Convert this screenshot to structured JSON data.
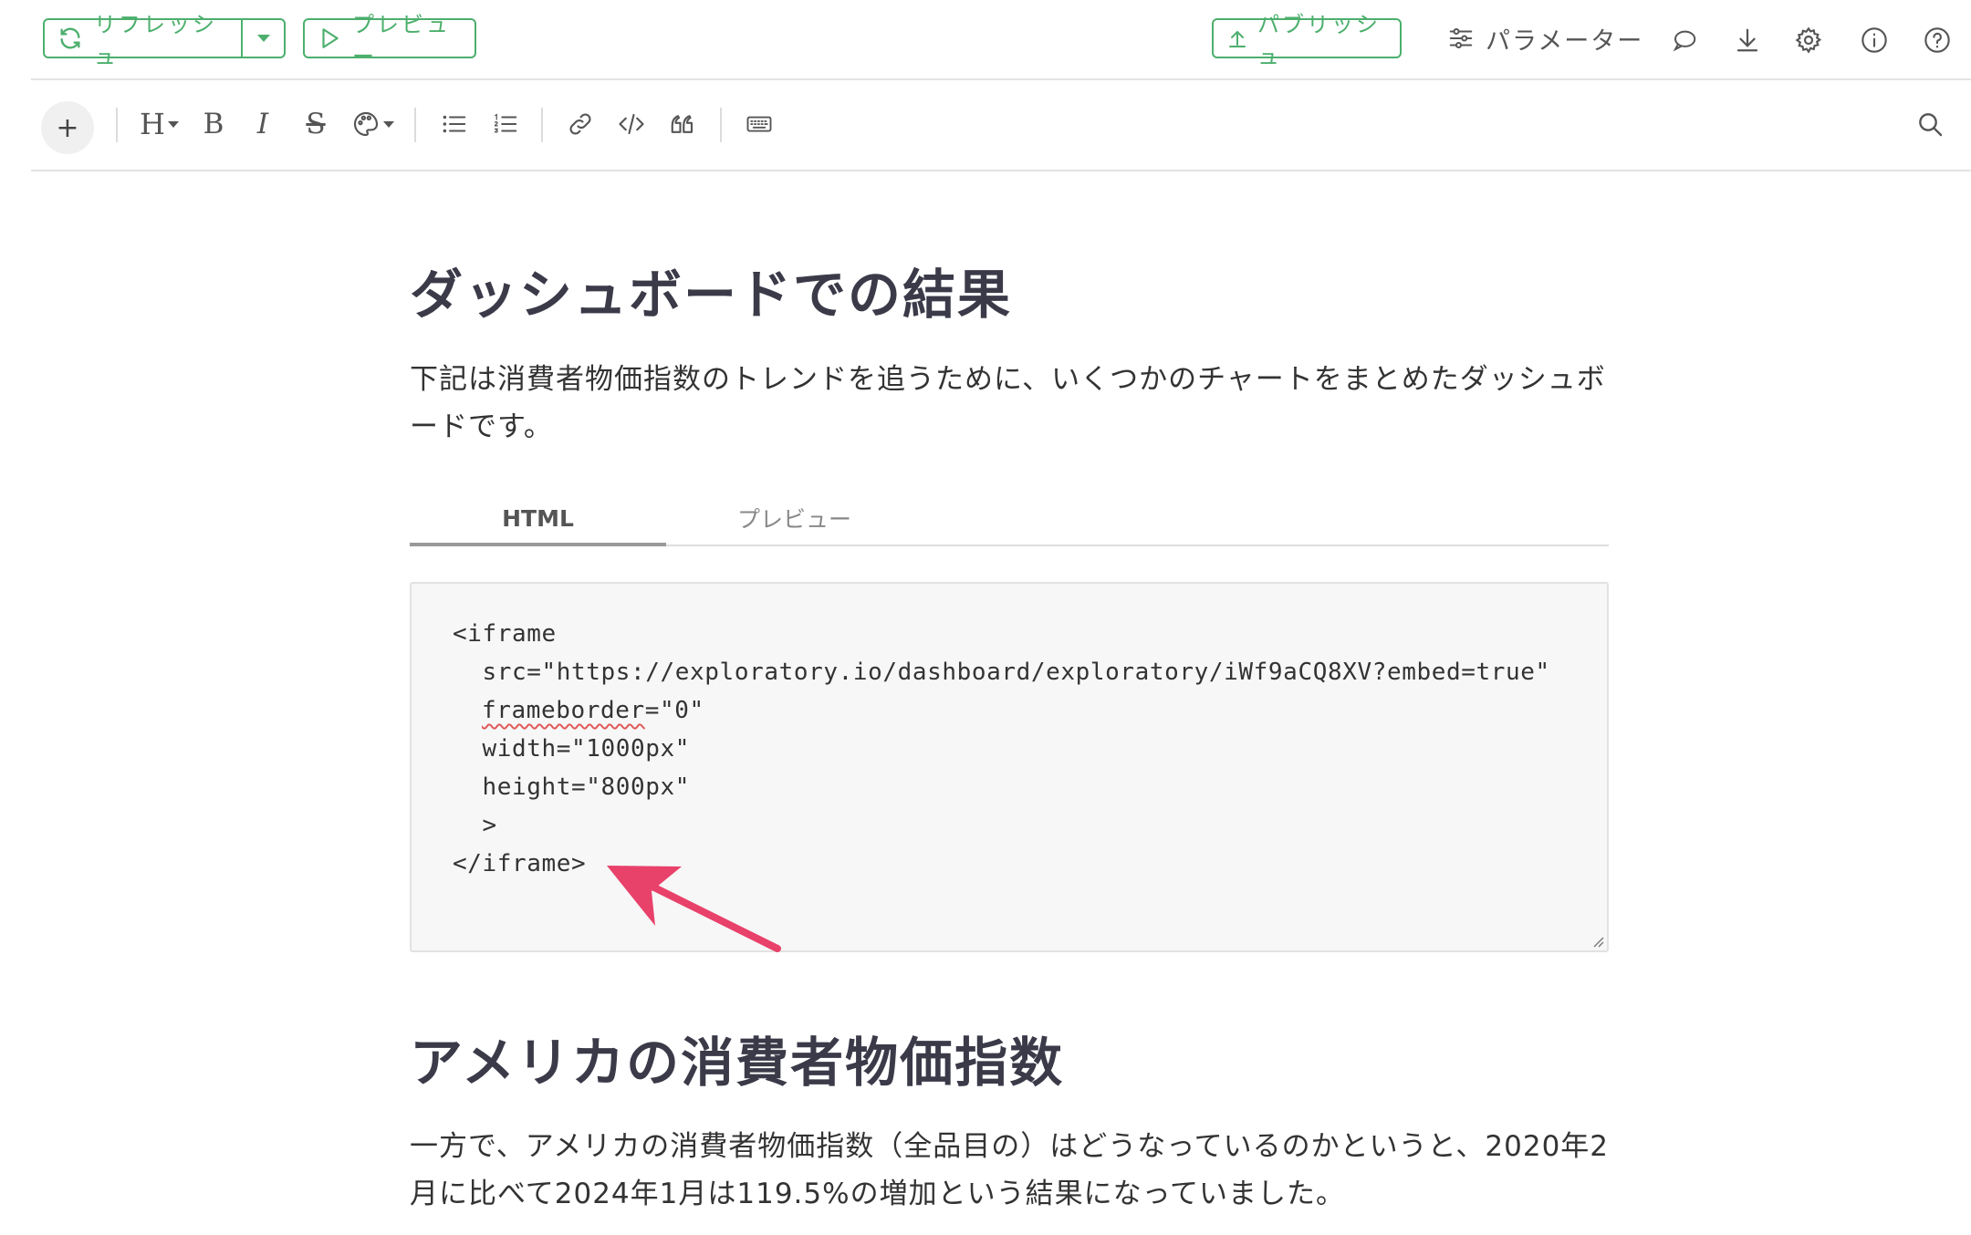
{
  "toolbar_top": {
    "refresh_label": "リフレッシュ",
    "preview_label": "プレビュー",
    "publish_label": "パブリッシュ",
    "parameters_label": "パラメーター"
  },
  "editor_toolbar": {
    "add_label": "+",
    "heading_label": "H",
    "bold_label": "B",
    "italic_label": "I",
    "strike_label": "S"
  },
  "content": {
    "section1_title": "ダッシュボードでの結果",
    "section1_para": "下記は消費者物価指数のトレンドを追うために、いくつかのチャートをまとめたダッシュボードです。",
    "tabs": [
      {
        "label": "HTML",
        "active": true
      },
      {
        "label": "プレビュー",
        "active": false
      }
    ],
    "code_lines": [
      "<iframe",
      "  src=\"https://exploratory.io/dashboard/exploratory/iWf9aCQ8XV?embed=true\"",
      "frameborder",
      "=\"0\"",
      "  width=\"1000px\"",
      "  height=\"800px\"",
      "  >",
      "</iframe>"
    ],
    "section2_title": "アメリカの消費者物価指数",
    "section2_para": "一方で、アメリカの消費者物価指数（全品目の）はどうなっているのかというと、2020年2月に比べて2024年1月は119.5%の増加という結果になっていました。"
  },
  "colors": {
    "accent_green": "#4caf6d",
    "heading": "#3a3a49",
    "arrow": "#e8416a"
  }
}
